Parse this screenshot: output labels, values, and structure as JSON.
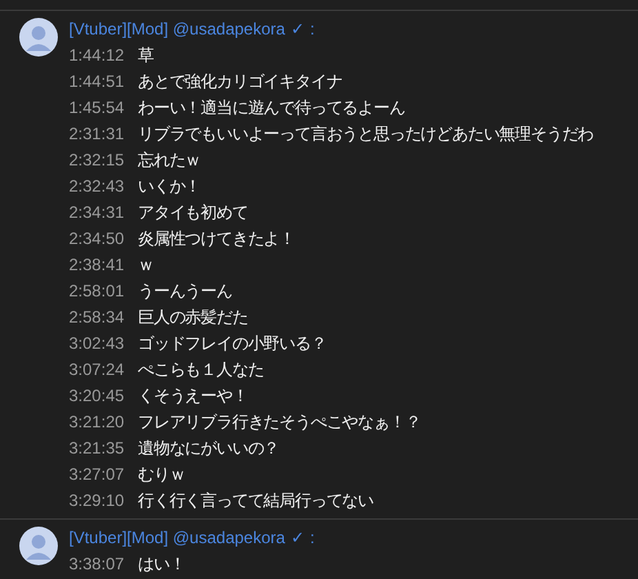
{
  "groups": [
    {
      "author": "[Vtuber][Mod] @usadapekora",
      "verified": "✓",
      "separator": ":",
      "messages": [
        {
          "time": "1:44:12",
          "text": "草"
        },
        {
          "time": "1:44:51",
          "text": "あとで強化カリゴイキタイナ"
        },
        {
          "time": "1:45:54",
          "text": "わーい！適当に遊んで待ってるよーん"
        },
        {
          "time": "2:31:31",
          "text": "リブラでもいいよーって言おうと思ったけどあたい無理そうだわ"
        },
        {
          "time": "2:32:15",
          "text": "忘れたｗ"
        },
        {
          "time": "2:32:43",
          "text": "いくか！"
        },
        {
          "time": "2:34:31",
          "text": "アタイも初めて"
        },
        {
          "time": "2:34:50",
          "text": "炎属性つけてきたよ！"
        },
        {
          "time": "2:38:41",
          "text": "ｗ"
        },
        {
          "time": "2:58:01",
          "text": "うーんうーん"
        },
        {
          "time": "2:58:34",
          "text": "巨人の赤髪だた"
        },
        {
          "time": "3:02:43",
          "text": "ゴッドフレイの小野いる？"
        },
        {
          "time": "3:07:24",
          "text": "ぺこらも１人なた"
        },
        {
          "time": "3:20:45",
          "text": "くそうえーや！"
        },
        {
          "time": "3:21:20",
          "text": "フレアリブラ行きたそうぺこやなぁ！？"
        },
        {
          "time": "3:21:35",
          "text": "遺物なにがいいの？"
        },
        {
          "time": "3:27:07",
          "text": "むりｗ"
        },
        {
          "time": "3:29:10",
          "text": "行く行く言ってて結局行ってない"
        }
      ]
    },
    {
      "author": "[Vtuber][Mod] @usadapekora",
      "verified": "✓",
      "separator": ":",
      "messages": [
        {
          "time": "3:38:07",
          "text": "はい！"
        }
      ]
    }
  ]
}
